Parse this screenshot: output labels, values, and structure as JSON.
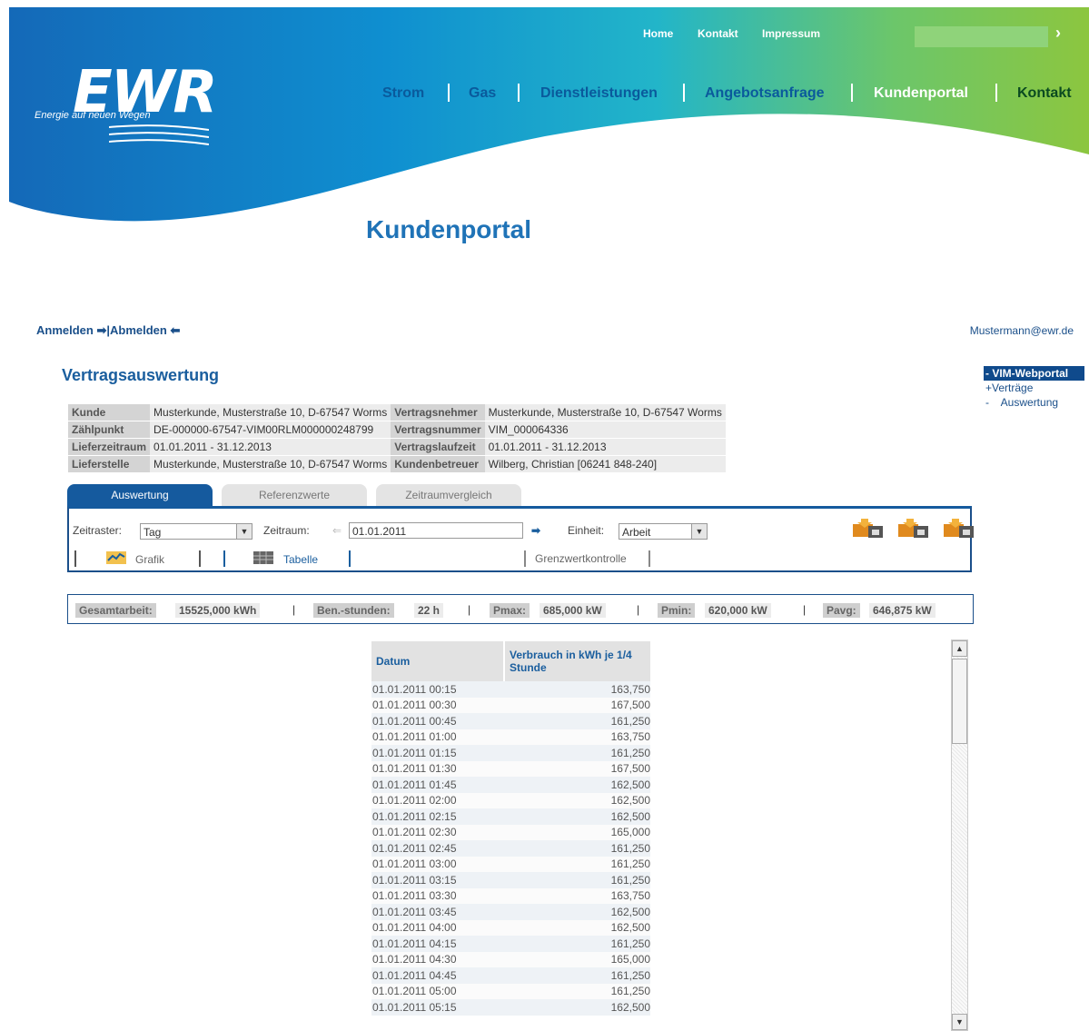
{
  "header": {
    "logo": "EWR",
    "tagline": "Energie auf neuen Wegen",
    "top_links": [
      "Home",
      "Kontakt",
      "Impressum"
    ],
    "search_go": "›",
    "main_nav": [
      "Strom",
      "Gas",
      "Dienstleistungen",
      "Angebotsanfrage",
      "Kundenportal",
      "Kontakt"
    ],
    "page_title": "Kundenportal"
  },
  "auth": {
    "login": "Anmelden",
    "separator": "|",
    "logout": "Abmelden",
    "user_email": "Mustermann@ewr.de"
  },
  "side_menu": {
    "active": "- VIM-Webportal",
    "items": [
      "+Verträge",
      "-    Auswertung"
    ]
  },
  "title": "Vertragsauswertung",
  "info": {
    "rows": [
      {
        "k1": "Kunde",
        "v1": "Musterkunde, Musterstraße 10, D-67547 Worms",
        "k2": "Vertragsnehmer",
        "v2": "Musterkunde, Musterstraße 10, D-67547 Worms"
      },
      {
        "k1": "Zählpunkt",
        "v1": "DE-000000-67547-VIM00RLM000000248799",
        "k2": "Vertragsnummer",
        "v2": "VIM_000064336"
      },
      {
        "k1": "Lieferzeitraum",
        "v1": "01.01.2011 - 31.12.2013",
        "k2": "Vertragslaufzeit",
        "v2": "01.01.2011 - 31.12.2013"
      },
      {
        "k1": "Lieferstelle",
        "v1": "Musterkunde, Musterstraße 10, D-67547 Worms",
        "k2": "Kundenbetreuer",
        "v2": "Wilberg, Christian [06241 848-240]"
      }
    ]
  },
  "tabs": [
    "Auswertung",
    "Referenzwerte",
    "Zeitraumvergleich"
  ],
  "controls": {
    "zeitraster_label": "Zeitraster:",
    "zeitraster_value": "Tag",
    "zeitraum_label": "Zeitraum:",
    "zeitraum_value": "01.01.2011",
    "einheit_label": "Einheit:",
    "einheit_value": "Arbeit",
    "view_grafik": "Grafik",
    "view_tabelle": "Tabelle",
    "view_grenzwert": "Grenzwertkontrolle",
    "export_icons": [
      "xls-export-icon",
      "csv-export-icon",
      "pdf-export-icon"
    ]
  },
  "summary": [
    {
      "label": "Gesamtarbeit:",
      "value": "15525,000 kWh"
    },
    {
      "label": "Ben.-stunden:",
      "value": "22 h"
    },
    {
      "label": "Pmax:",
      "value": "685,000 kW"
    },
    {
      "label": "Pmin:",
      "value": "620,000 kW"
    },
    {
      "label": "Pavg:",
      "value": "646,875 kW"
    }
  ],
  "table": {
    "headers": [
      "Datum",
      "Verbrauch in kWh je 1/4 Stunde"
    ],
    "rows": [
      [
        "01.01.2011 00:15",
        "163,750"
      ],
      [
        "01.01.2011 00:30",
        "167,500"
      ],
      [
        "01.01.2011 00:45",
        "161,250"
      ],
      [
        "01.01.2011 01:00",
        "163,750"
      ],
      [
        "01.01.2011 01:15",
        "161,250"
      ],
      [
        "01.01.2011 01:30",
        "167,500"
      ],
      [
        "01.01.2011 01:45",
        "162,500"
      ],
      [
        "01.01.2011 02:00",
        "162,500"
      ],
      [
        "01.01.2011 02:15",
        "162,500"
      ],
      [
        "01.01.2011 02:30",
        "165,000"
      ],
      [
        "01.01.2011 02:45",
        "161,250"
      ],
      [
        "01.01.2011 03:00",
        "161,250"
      ],
      [
        "01.01.2011 03:15",
        "161,250"
      ],
      [
        "01.01.2011 03:30",
        "163,750"
      ],
      [
        "01.01.2011 03:45",
        "162,500"
      ],
      [
        "01.01.2011 04:00",
        "162,500"
      ],
      [
        "01.01.2011 04:15",
        "161,250"
      ],
      [
        "01.01.2011 04:30",
        "165,000"
      ],
      [
        "01.01.2011 04:45",
        "161,250"
      ],
      [
        "01.01.2011 05:00",
        "161,250"
      ],
      [
        "01.01.2011 05:15",
        "162,500"
      ]
    ]
  },
  "colors": {
    "brand_blue": "#1f73b7",
    "nav_blue": "#0a5a9c",
    "tab_active": "#155a9e",
    "wave_green": "#7cc242"
  }
}
